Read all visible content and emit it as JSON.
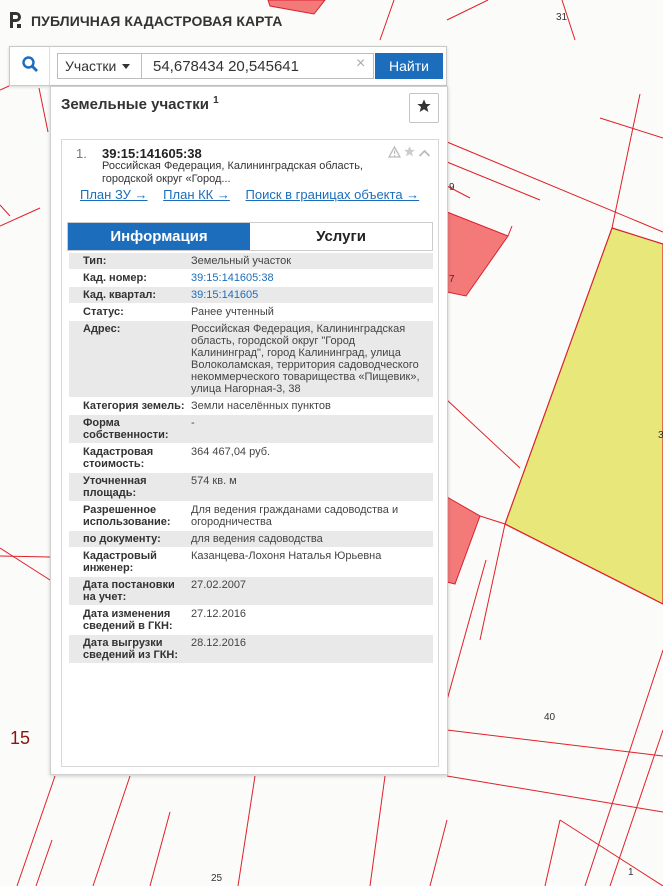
{
  "header": {
    "app_title": "ПУБЛИЧНАЯ КАДАСТРОВАЯ КАРТА"
  },
  "map": {
    "labels": [
      "31",
      "9",
      "7",
      "40",
      "25",
      "1",
      "3"
    ],
    "big_label": "15"
  },
  "search": {
    "type_label": "Участки",
    "query": "54,678434 20,545641",
    "clear": "×",
    "find_label": "Найти"
  },
  "panel": {
    "title": "Земельные участки",
    "count": "1"
  },
  "result": {
    "index": "1.",
    "cad_number": "39:15:141605:38",
    "address_short": "Российская Федерация, Калининградская область, городской округ «Город...",
    "links": [
      "План ЗУ →",
      "План КК →",
      "Поиск в границах объекта →"
    ]
  },
  "tabs": [
    "Информация",
    "Услуги"
  ],
  "info_rows": [
    {
      "label": "Тип:",
      "value": "Земельный участок"
    },
    {
      "label": "Кад. номер:",
      "value": "39:15:141605:38"
    },
    {
      "label": "Кад. квартал:",
      "value": "39:15:141605"
    },
    {
      "label": "Статус:",
      "value": "Ранее учтенный"
    },
    {
      "label": "Адрес:",
      "value": "Российская Федерация, Калининградская область, городской округ \"Город Калининград\", город Калининград, улица Волоколамская, территория садоводческого некоммерческого товарищества «Пищевик», улица Нагорная-3, 38"
    },
    {
      "label": "Категория земель:",
      "value": "Земли населённых пунктов"
    },
    {
      "label": "Форма собственности:",
      "value": "-"
    },
    {
      "label": "Кадастровая стоимость:",
      "value": "364 467,04 руб."
    },
    {
      "label": "Уточненная площадь:",
      "value": "574 кв. м"
    },
    {
      "label": "Разрешенное использование:",
      "value": "Для ведения гражданами садоводства и огородничества"
    },
    {
      "label": "по документу:",
      "value": "для ведения садоводства"
    },
    {
      "label": "Кадастровый инженер:",
      "value": "Казанцева-Лохоня Наталья Юрьевна"
    },
    {
      "label": "Дата постановки на учет:",
      "value": "27.02.2007"
    },
    {
      "label": "Дата изменения сведений в ГКН:",
      "value": "27.12.2016"
    },
    {
      "label": "Дата выгрузки сведений из ГКН:",
      "value": "28.12.2016"
    }
  ],
  "colors": {
    "accent": "#1c6ebc",
    "parcel_red": "#f47a7a",
    "parcel_yellow": "#e8e87a",
    "boundary": "#e0202a"
  },
  "icons": [
    "logo-icon",
    "search-icon",
    "star-icon",
    "warning-icon",
    "chevron-up-icon"
  ]
}
